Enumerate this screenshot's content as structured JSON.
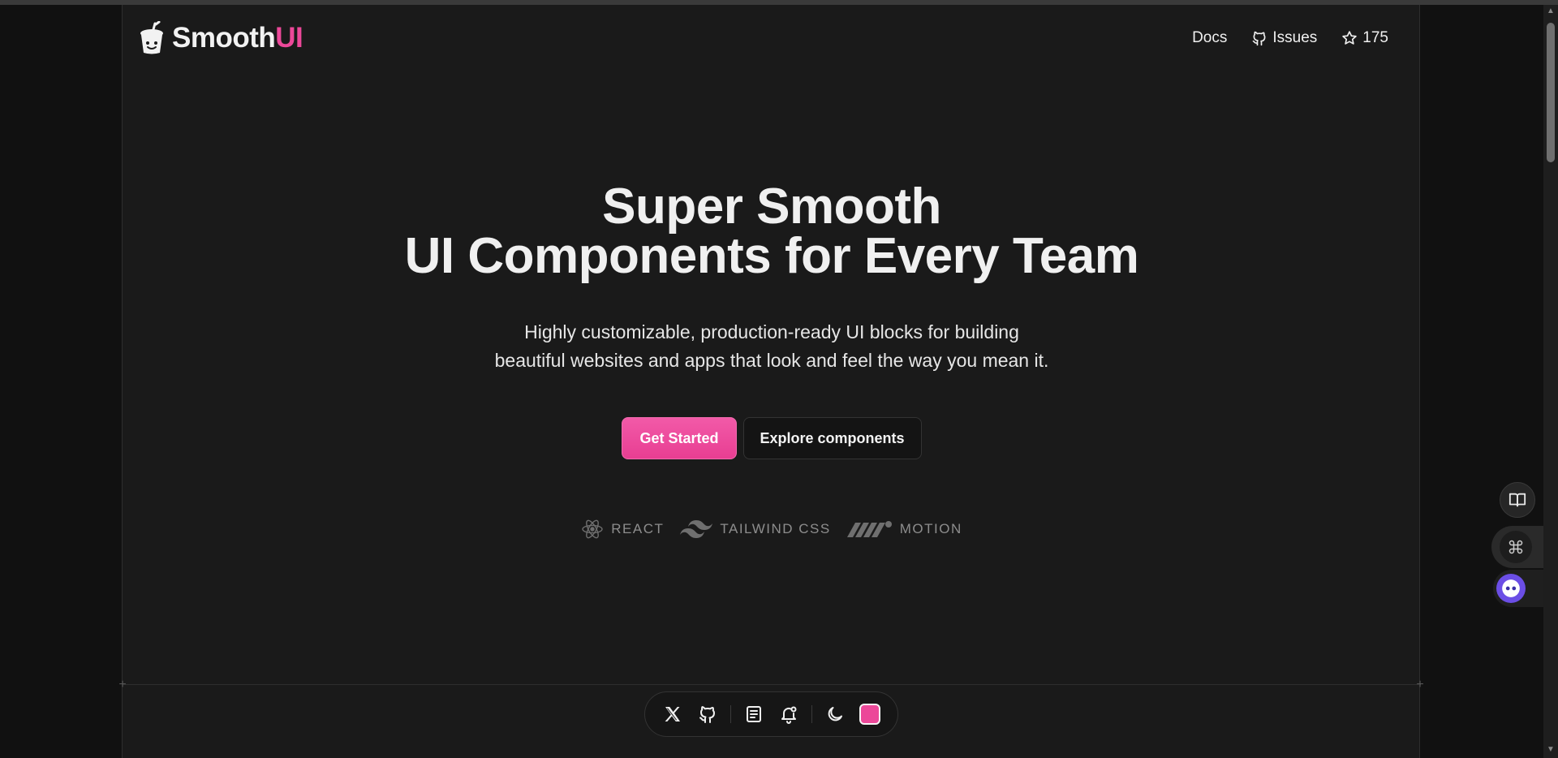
{
  "brand": {
    "name_main": "Smooth",
    "name_accent": "UI",
    "accent_color": "#ec4899"
  },
  "nav": {
    "docs": "Docs",
    "issues": "Issues",
    "stars": "175"
  },
  "hero": {
    "title_line1": "Super Smooth",
    "title_line2": "UI Components for Every Team",
    "subtitle_line1": "Highly customizable, production-ready UI blocks for building",
    "subtitle_line2": "beautiful websites and apps that look and feel the way you mean it.",
    "primary_cta": "Get Started",
    "secondary_cta": "Explore components"
  },
  "tech": [
    {
      "label": "REACT",
      "icon": "react-icon"
    },
    {
      "label": "TAILWIND CSS",
      "icon": "tailwind-icon"
    },
    {
      "label": "MOTION",
      "icon": "motion-icon"
    }
  ],
  "dock": {
    "items": [
      "x-icon",
      "github-icon",
      "docs-icon",
      "notification-icon",
      "moon-icon",
      "color-swatch"
    ],
    "swatch_color": "#ec4899"
  },
  "floating": [
    "book-icon",
    "command-icon",
    "assistant-bot-icon"
  ]
}
